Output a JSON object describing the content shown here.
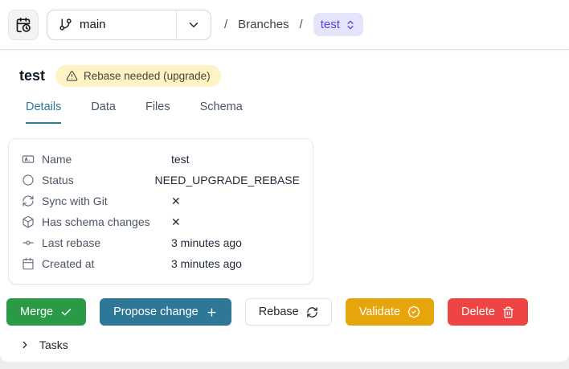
{
  "topbar": {
    "branch_selector": {
      "value": "main"
    },
    "breadcrumb": {
      "separator": "/",
      "section": "Branches",
      "current_branch": "test"
    }
  },
  "page": {
    "title": "test",
    "status_badge": "Rebase needed (upgrade)"
  },
  "tabs": [
    {
      "label": "Details"
    },
    {
      "label": "Data"
    },
    {
      "label": "Files"
    },
    {
      "label": "Schema"
    }
  ],
  "details": {
    "rows": [
      {
        "icon": "input-field-icon",
        "label": "Name",
        "value": "test"
      },
      {
        "icon": "circle-icon",
        "label": "Status",
        "value": "NEED_UPGRADE_REBASE"
      },
      {
        "icon": "sync-icon",
        "label": "Sync with Git",
        "value": "✕"
      },
      {
        "icon": "cube-icon",
        "label": "Has schema changes",
        "value": "✕"
      },
      {
        "icon": "commit-icon",
        "label": "Last rebase",
        "value": "3 minutes ago"
      },
      {
        "icon": "calendar-icon",
        "label": "Created at",
        "value": "3 minutes ago"
      }
    ]
  },
  "actions": {
    "merge": "Merge",
    "propose": "Propose change",
    "rebase": "Rebase",
    "validate": "Validate",
    "delete": "Delete"
  },
  "tasks": {
    "label": "Tasks"
  },
  "colors": {
    "accent_teal": "#2d7a9b",
    "merge_green": "#2b9a47",
    "propose_blue": "#2e7797",
    "validate_amber": "#e7a50c",
    "delete_red": "#ef4444",
    "status_badge_bg": "#fdf3c4",
    "branch_pill_bg": "#e4e4fb",
    "branch_pill_text": "#4f46e5"
  }
}
